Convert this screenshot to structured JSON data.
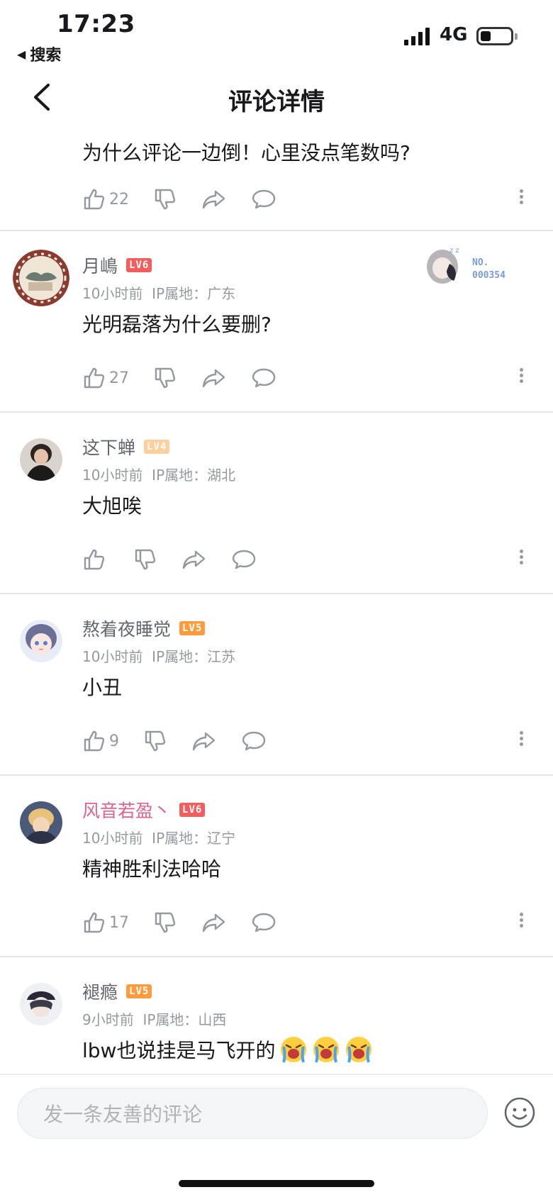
{
  "status_bar": {
    "time": "17:23",
    "back_app": "搜索",
    "network": "4G"
  },
  "header": {
    "title": "评论详情"
  },
  "top_comment": {
    "text": "为什么评论一边倒！心里没点笔数吗?",
    "likes": "22"
  },
  "comments": [
    {
      "username": "月嶋",
      "level": "LV6",
      "time": "10小时前",
      "ip": "IP属地：广东",
      "text": "光明磊落为什么要删?",
      "likes": "27",
      "fan_badge": "NO.\n000354"
    },
    {
      "username": "这下蝉",
      "level": "LV4",
      "time": "10小时前",
      "ip": "IP属地：湖北",
      "text": "大旭唉",
      "likes": ""
    },
    {
      "username": "熬着夜睡觉",
      "level": "LV5",
      "time": "10小时前",
      "ip": "IP属地：江苏",
      "text": "小丑",
      "likes": "9"
    },
    {
      "username": "风音若盈丶",
      "level": "LV6",
      "time": "10小时前",
      "ip": "IP属地：辽宁",
      "text": "精神胜利法哈哈",
      "likes": "17"
    },
    {
      "username": "褪瘾",
      "level": "LV5",
      "time": "9小时前",
      "ip": "IP属地：山西",
      "text": "lbw也说挂是马飞开的",
      "likes": ""
    }
  ],
  "input": {
    "placeholder": "发一条友善的评论"
  },
  "colors": {
    "accent_pink": "#e0608e",
    "lv6": "#f25d5d",
    "lv5": "#ff9b3d",
    "lv4": "#ffcf9c",
    "meta_gray": "#9499a0"
  }
}
